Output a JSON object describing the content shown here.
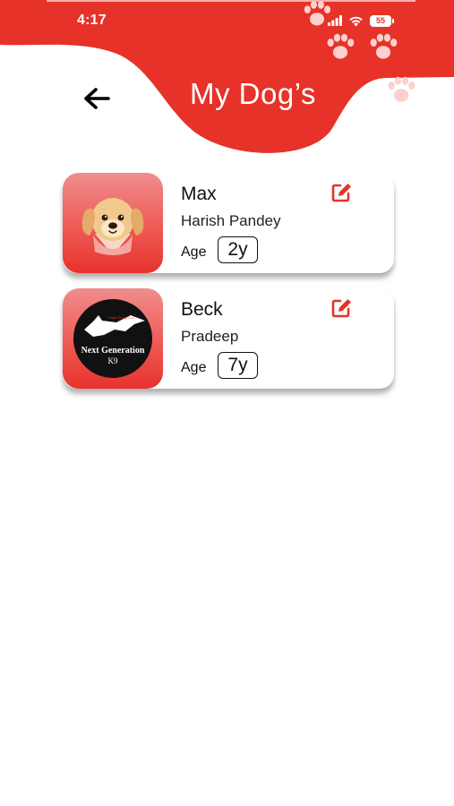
{
  "status_bar": {
    "time": "4:17",
    "battery": "55",
    "icons": [
      "signal-icon",
      "wifi-icon",
      "battery-icon"
    ]
  },
  "header": {
    "title": "My Dog’s",
    "back_icon": "arrow-left-icon",
    "decorations": [
      "paw-print-icon"
    ]
  },
  "colors": {
    "accent": "#e63228",
    "avatar_gradient_top": "#f08d8d",
    "avatar_gradient_bottom": "#e8322c",
    "background": "#ffffff"
  },
  "dogs": [
    {
      "name": "Max",
      "owner": "Harish Pandey",
      "age_label": "Age",
      "age": "2y",
      "avatar": "cartoon-dog-avatar",
      "edit_icon": "edit-icon"
    },
    {
      "name": "Beck",
      "owner": "Pradeep",
      "age_label": "Age",
      "age": "7y",
      "avatar": "next-generation-k9-logo",
      "avatar_logo": {
        "top_text": "Pack Group LLC",
        "main_text": "Next Generation",
        "sub_text": "K9"
      },
      "edit_icon": "edit-icon"
    }
  ]
}
